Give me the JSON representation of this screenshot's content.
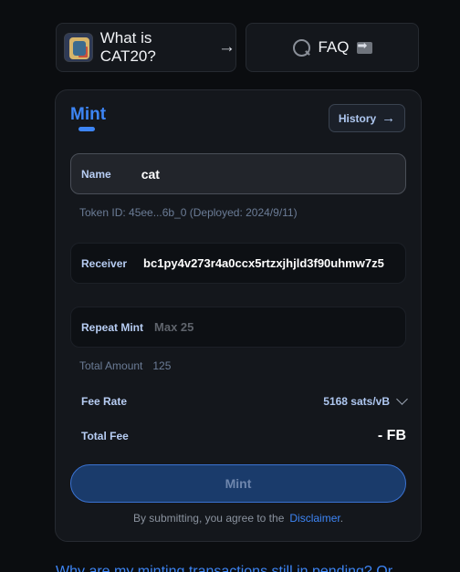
{
  "topbar": {
    "about_label": "What is CAT20?",
    "faq_label": "FAQ"
  },
  "card": {
    "tab_mint": "Mint",
    "history_label": "History",
    "name": {
      "label": "Name",
      "value": "cat"
    },
    "token_info": "Token ID: 45ee...6b_0 (Deployed: 2024/9/11)",
    "receiver": {
      "label": "Receiver",
      "value": "bc1py4v273r4a0ccx5rtzxjhjld3f90uhmw7z5"
    },
    "repeat_mint": {
      "label": "Repeat Mint",
      "placeholder": "Max 25"
    },
    "total_amount": {
      "label": "Total Amount",
      "value": "125"
    },
    "fee_rate": {
      "label": "Fee Rate",
      "value": "5168 sats/vB"
    },
    "total_fee": {
      "label": "Total Fee",
      "value": "- FB"
    },
    "mint_button": "Mint",
    "terms_text": "By submitting, you agree to the",
    "disclaimer_link": "Disclaimer",
    "terms_suffix": "."
  },
  "faq_link": "Why are my minting transactions still in pending? Or",
  "colors": {
    "accent": "#3d85f5",
    "background": "#0b0d10",
    "card": "#14171c"
  }
}
